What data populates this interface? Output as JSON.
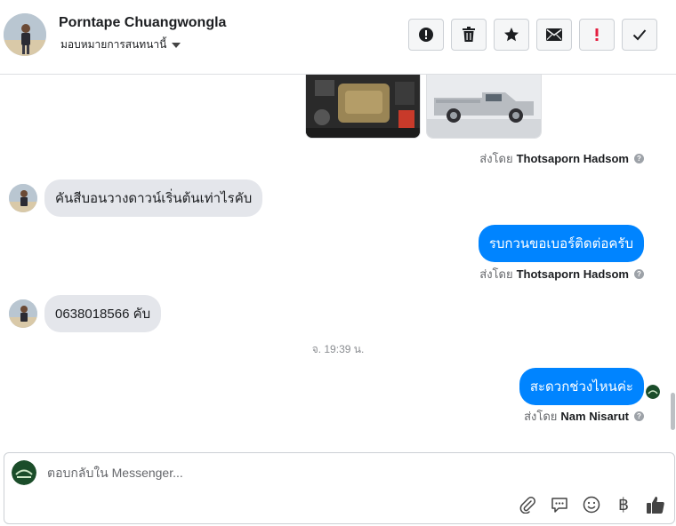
{
  "header": {
    "contact_name": "Porntape Chuangwongla",
    "assign_label": "มอบหมายการสนทนานี้",
    "actions": [
      {
        "icon": "exclamation-circle-icon"
      },
      {
        "icon": "trash-icon"
      },
      {
        "icon": "star-icon"
      },
      {
        "icon": "envelope-icon"
      },
      {
        "icon": "exclamation-red-icon"
      },
      {
        "icon": "checkmark-icon"
      }
    ]
  },
  "messages": {
    "m1_sent_prefix": "ส่งโดย",
    "m1_sent_name": "Thotsaporn Hadsom",
    "m2_text": "คันสีบอนวางดาวน์เริ่นต้นเท่าไรคับ",
    "m3_text": "รบกวนขอเบอร์ติดต่อครับ",
    "m3_sent_prefix": "ส่งโดย",
    "m3_sent_name": "Thotsaporn Hadsom",
    "m4_text": "0638018566 คับ",
    "timestamp": "จ. 19:39 น.",
    "m5_text": "สะดวกช่วงไหนค่ะ",
    "m5_sent_prefix": "ส่งโดย",
    "m5_sent_name": "Nam Nisarut",
    "help_glyph": "?"
  },
  "composer": {
    "placeholder": "ตอบกลับใน Messenger...",
    "tools": [
      "paperclip-icon",
      "saved-reply-icon",
      "emoji-icon",
      "baht-icon",
      "thumbs-up-icon"
    ],
    "baht_glyph": "฿"
  },
  "colors": {
    "outgoing_bubble": "#0084ff",
    "incoming_bubble": "#e4e6eb",
    "alert_red": "#e41e3f"
  }
}
